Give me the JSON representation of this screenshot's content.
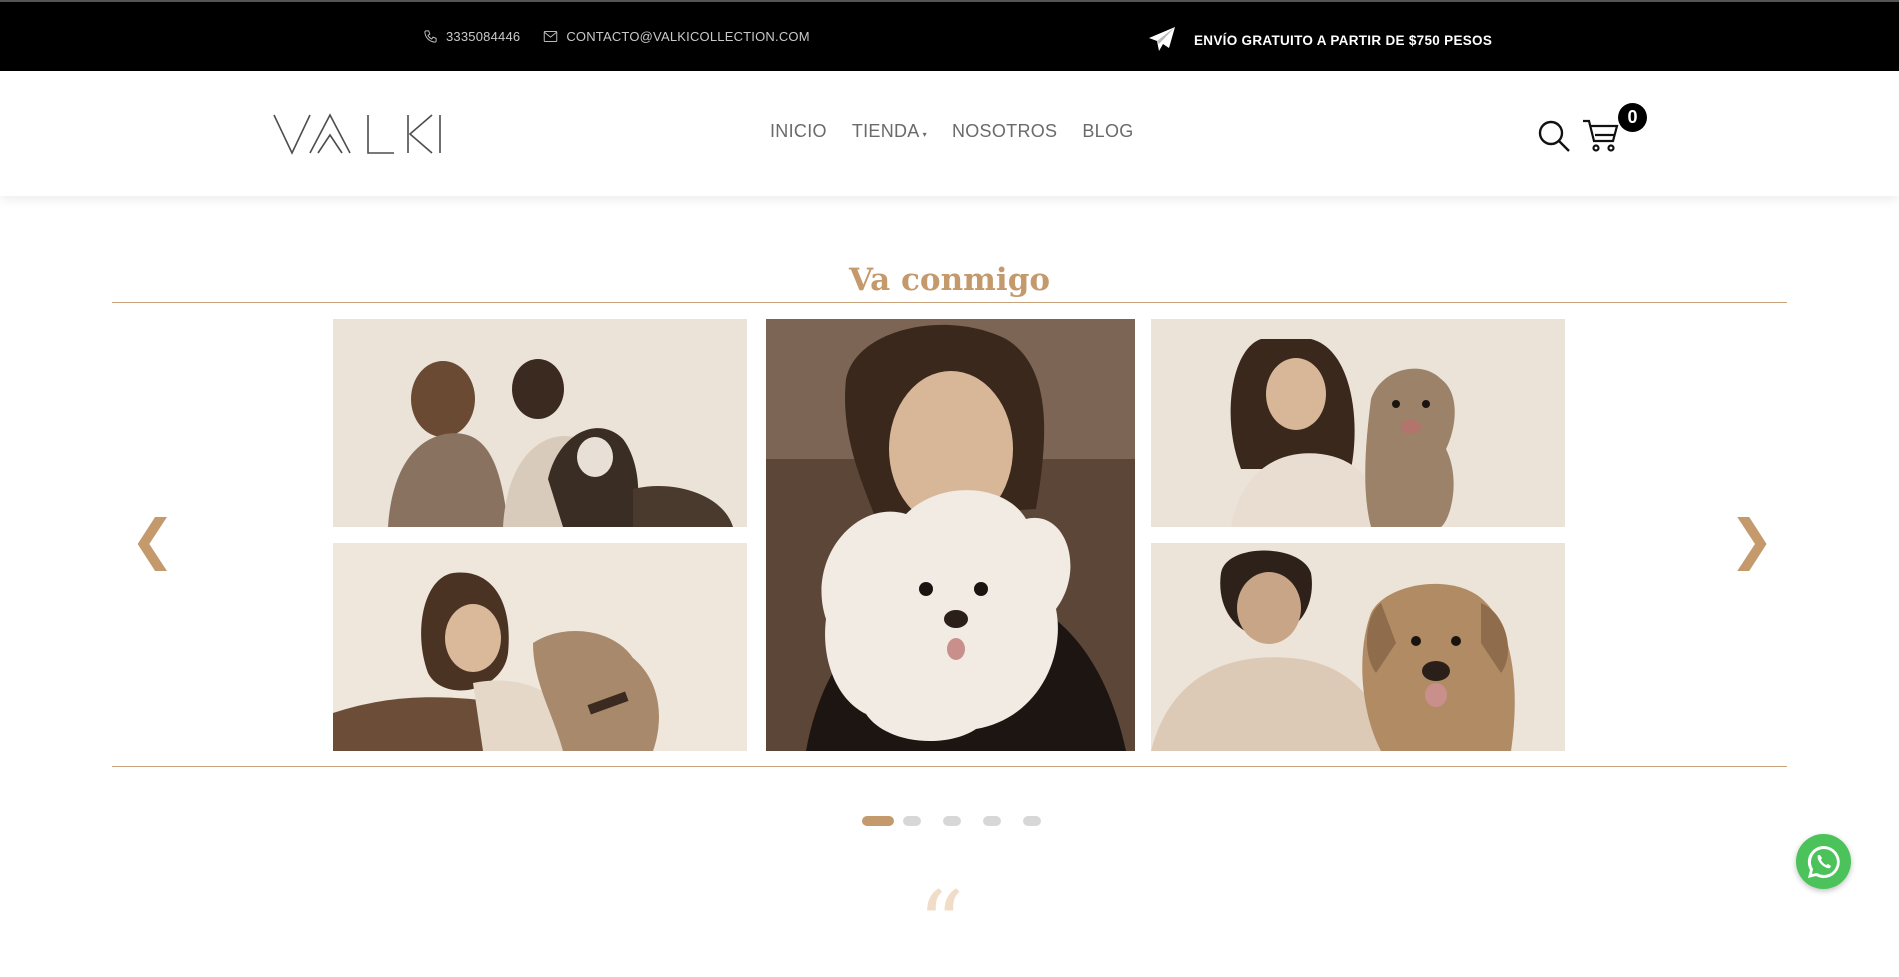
{
  "topbar": {
    "phone": "3335084446",
    "email": "CONTACTO@VALKICOLLECTION.COM",
    "shipping": "ENVÍO GRATUITO A PARTIR DE $750 PESOS",
    "icons": [
      "phone-icon",
      "mail-icon",
      "paper-plane-icon"
    ]
  },
  "header": {
    "logo": "VALKI",
    "nav": [
      {
        "label": "INICIO"
      },
      {
        "label": "TIENDA"
      },
      {
        "label": "NOSOTROS"
      },
      {
        "label": "BLOG"
      }
    ],
    "cart_count": "0",
    "icons": [
      "search-icon",
      "cart-icon"
    ]
  },
  "section": {
    "title": "Va conmigo",
    "prev": "❮",
    "next": "❯",
    "photos": [
      "couple with husky",
      "woman with greyhound",
      "woman with white poodle",
      "woman with terrier",
      "man with golden retriever"
    ],
    "slides_total": 5,
    "active_slide": 1
  },
  "quote_mark": "“",
  "colors": {
    "accent": "#c49a6c",
    "topbar_bg": "#000000",
    "whatsapp": "#4bc25a",
    "dot_inactive": "#d7d7d7"
  }
}
